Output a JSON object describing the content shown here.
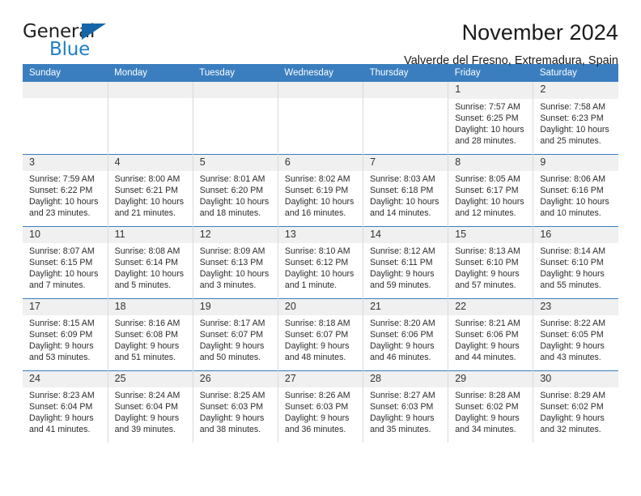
{
  "brand": {
    "word1": "General",
    "word2": "Blue",
    "triangle_color": "#1566a8",
    "blue_color": "#1f7ec4"
  },
  "header": {
    "title": "November 2024",
    "location": "Valverde del Fresno, Extremadura, Spain"
  },
  "theme": {
    "header_blue": "#3a7ebf",
    "daynum_bg": "#f0f0f0",
    "cell_border": "#d9d9d9"
  },
  "weekdays": [
    "Sunday",
    "Monday",
    "Tuesday",
    "Wednesday",
    "Thursday",
    "Friday",
    "Saturday"
  ],
  "labels": {
    "sunrise_prefix": "Sunrise:",
    "sunset_prefix": "Sunset:",
    "daylight_prefix": "Daylight:"
  },
  "weeks": [
    [
      {
        "day": "",
        "empty": true
      },
      {
        "day": "",
        "empty": true
      },
      {
        "day": "",
        "empty": true
      },
      {
        "day": "",
        "empty": true
      },
      {
        "day": "",
        "empty": true
      },
      {
        "day": "1",
        "sunrise": "Sunrise: 7:57 AM",
        "sunset": "Sunset: 6:25 PM",
        "daylight": "Daylight: 10 hours and 28 minutes."
      },
      {
        "day": "2",
        "sunrise": "Sunrise: 7:58 AM",
        "sunset": "Sunset: 6:23 PM",
        "daylight": "Daylight: 10 hours and 25 minutes."
      }
    ],
    [
      {
        "day": "3",
        "sunrise": "Sunrise: 7:59 AM",
        "sunset": "Sunset: 6:22 PM",
        "daylight": "Daylight: 10 hours and 23 minutes."
      },
      {
        "day": "4",
        "sunrise": "Sunrise: 8:00 AM",
        "sunset": "Sunset: 6:21 PM",
        "daylight": "Daylight: 10 hours and 21 minutes."
      },
      {
        "day": "5",
        "sunrise": "Sunrise: 8:01 AM",
        "sunset": "Sunset: 6:20 PM",
        "daylight": "Daylight: 10 hours and 18 minutes."
      },
      {
        "day": "6",
        "sunrise": "Sunrise: 8:02 AM",
        "sunset": "Sunset: 6:19 PM",
        "daylight": "Daylight: 10 hours and 16 minutes."
      },
      {
        "day": "7",
        "sunrise": "Sunrise: 8:03 AM",
        "sunset": "Sunset: 6:18 PM",
        "daylight": "Daylight: 10 hours and 14 minutes."
      },
      {
        "day": "8",
        "sunrise": "Sunrise: 8:05 AM",
        "sunset": "Sunset: 6:17 PM",
        "daylight": "Daylight: 10 hours and 12 minutes."
      },
      {
        "day": "9",
        "sunrise": "Sunrise: 8:06 AM",
        "sunset": "Sunset: 6:16 PM",
        "daylight": "Daylight: 10 hours and 10 minutes."
      }
    ],
    [
      {
        "day": "10",
        "sunrise": "Sunrise: 8:07 AM",
        "sunset": "Sunset: 6:15 PM",
        "daylight": "Daylight: 10 hours and 7 minutes."
      },
      {
        "day": "11",
        "sunrise": "Sunrise: 8:08 AM",
        "sunset": "Sunset: 6:14 PM",
        "daylight": "Daylight: 10 hours and 5 minutes."
      },
      {
        "day": "12",
        "sunrise": "Sunrise: 8:09 AM",
        "sunset": "Sunset: 6:13 PM",
        "daylight": "Daylight: 10 hours and 3 minutes."
      },
      {
        "day": "13",
        "sunrise": "Sunrise: 8:10 AM",
        "sunset": "Sunset: 6:12 PM",
        "daylight": "Daylight: 10 hours and 1 minute."
      },
      {
        "day": "14",
        "sunrise": "Sunrise: 8:12 AM",
        "sunset": "Sunset: 6:11 PM",
        "daylight": "Daylight: 9 hours and 59 minutes."
      },
      {
        "day": "15",
        "sunrise": "Sunrise: 8:13 AM",
        "sunset": "Sunset: 6:10 PM",
        "daylight": "Daylight: 9 hours and 57 minutes."
      },
      {
        "day": "16",
        "sunrise": "Sunrise: 8:14 AM",
        "sunset": "Sunset: 6:10 PM",
        "daylight": "Daylight: 9 hours and 55 minutes."
      }
    ],
    [
      {
        "day": "17",
        "sunrise": "Sunrise: 8:15 AM",
        "sunset": "Sunset: 6:09 PM",
        "daylight": "Daylight: 9 hours and 53 minutes."
      },
      {
        "day": "18",
        "sunrise": "Sunrise: 8:16 AM",
        "sunset": "Sunset: 6:08 PM",
        "daylight": "Daylight: 9 hours and 51 minutes."
      },
      {
        "day": "19",
        "sunrise": "Sunrise: 8:17 AM",
        "sunset": "Sunset: 6:07 PM",
        "daylight": "Daylight: 9 hours and 50 minutes."
      },
      {
        "day": "20",
        "sunrise": "Sunrise: 8:18 AM",
        "sunset": "Sunset: 6:07 PM",
        "daylight": "Daylight: 9 hours and 48 minutes."
      },
      {
        "day": "21",
        "sunrise": "Sunrise: 8:20 AM",
        "sunset": "Sunset: 6:06 PM",
        "daylight": "Daylight: 9 hours and 46 minutes."
      },
      {
        "day": "22",
        "sunrise": "Sunrise: 8:21 AM",
        "sunset": "Sunset: 6:06 PM",
        "daylight": "Daylight: 9 hours and 44 minutes."
      },
      {
        "day": "23",
        "sunrise": "Sunrise: 8:22 AM",
        "sunset": "Sunset: 6:05 PM",
        "daylight": "Daylight: 9 hours and 43 minutes."
      }
    ],
    [
      {
        "day": "24",
        "sunrise": "Sunrise: 8:23 AM",
        "sunset": "Sunset: 6:04 PM",
        "daylight": "Daylight: 9 hours and 41 minutes."
      },
      {
        "day": "25",
        "sunrise": "Sunrise: 8:24 AM",
        "sunset": "Sunset: 6:04 PM",
        "daylight": "Daylight: 9 hours and 39 minutes."
      },
      {
        "day": "26",
        "sunrise": "Sunrise: 8:25 AM",
        "sunset": "Sunset: 6:03 PM",
        "daylight": "Daylight: 9 hours and 38 minutes."
      },
      {
        "day": "27",
        "sunrise": "Sunrise: 8:26 AM",
        "sunset": "Sunset: 6:03 PM",
        "daylight": "Daylight: 9 hours and 36 minutes."
      },
      {
        "day": "28",
        "sunrise": "Sunrise: 8:27 AM",
        "sunset": "Sunset: 6:03 PM",
        "daylight": "Daylight: 9 hours and 35 minutes."
      },
      {
        "day": "29",
        "sunrise": "Sunrise: 8:28 AM",
        "sunset": "Sunset: 6:02 PM",
        "daylight": "Daylight: 9 hours and 34 minutes."
      },
      {
        "day": "30",
        "sunrise": "Sunrise: 8:29 AM",
        "sunset": "Sunset: 6:02 PM",
        "daylight": "Daylight: 9 hours and 32 minutes."
      }
    ]
  ]
}
